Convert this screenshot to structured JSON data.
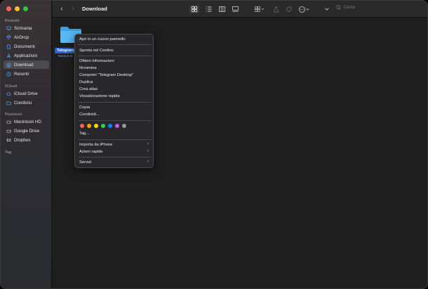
{
  "sidebar": {
    "sections": {
      "favorites": "Preferiti",
      "icloud": "iCloud",
      "locations": "Posizioni",
      "tags": "Tag"
    },
    "favorites": [
      {
        "label": "Scrivania",
        "icon": "desktop-icon"
      },
      {
        "label": "AirDrop",
        "icon": "airdrop-icon"
      },
      {
        "label": "Documenti",
        "icon": "document-icon"
      },
      {
        "label": "Applicazioni",
        "icon": "applications-icon"
      },
      {
        "label": "Download",
        "icon": "download-icon",
        "selected": true
      },
      {
        "label": "Recenti",
        "icon": "clock-icon"
      }
    ],
    "icloud": [
      {
        "label": "iCloud Drive",
        "icon": "cloud-icon"
      },
      {
        "label": "Condivisi",
        "icon": "shared-folder-icon"
      }
    ],
    "locations": [
      {
        "label": "Macintosh HD",
        "icon": "disk-icon"
      },
      {
        "label": "Google Drive",
        "icon": "disk-icon"
      },
      {
        "label": "Dropbox",
        "icon": "dropbox-icon"
      }
    ]
  },
  "toolbar": {
    "title": "Download",
    "search_placeholder": "Cerca"
  },
  "content": {
    "folder_label": "Telegram",
    "folder_sub": "Nessun el..."
  },
  "menu": {
    "open_new_tab": "Apri in un nuovo pannello",
    "move_to_trash": "Sposta nel Cestino",
    "get_info": "Ottieni informazioni",
    "rename": "Rinomina",
    "compress": "Comprimi “Telegram Desktop”",
    "duplicate": "Duplica",
    "make_alias": "Crea alias",
    "quick_look": "Visualizzazione rapida",
    "copy": "Copia",
    "share": "Condividi...",
    "tags": "Tag...",
    "import_iphone": "Importa da iPhone",
    "quick_actions": "Azioni rapide",
    "services": "Servizi",
    "tag_colors": [
      "#ff5f57",
      "#ff9f0a",
      "#ffd60a",
      "#30d158",
      "#0a84ff",
      "#bf5af2",
      "#98989d"
    ]
  }
}
